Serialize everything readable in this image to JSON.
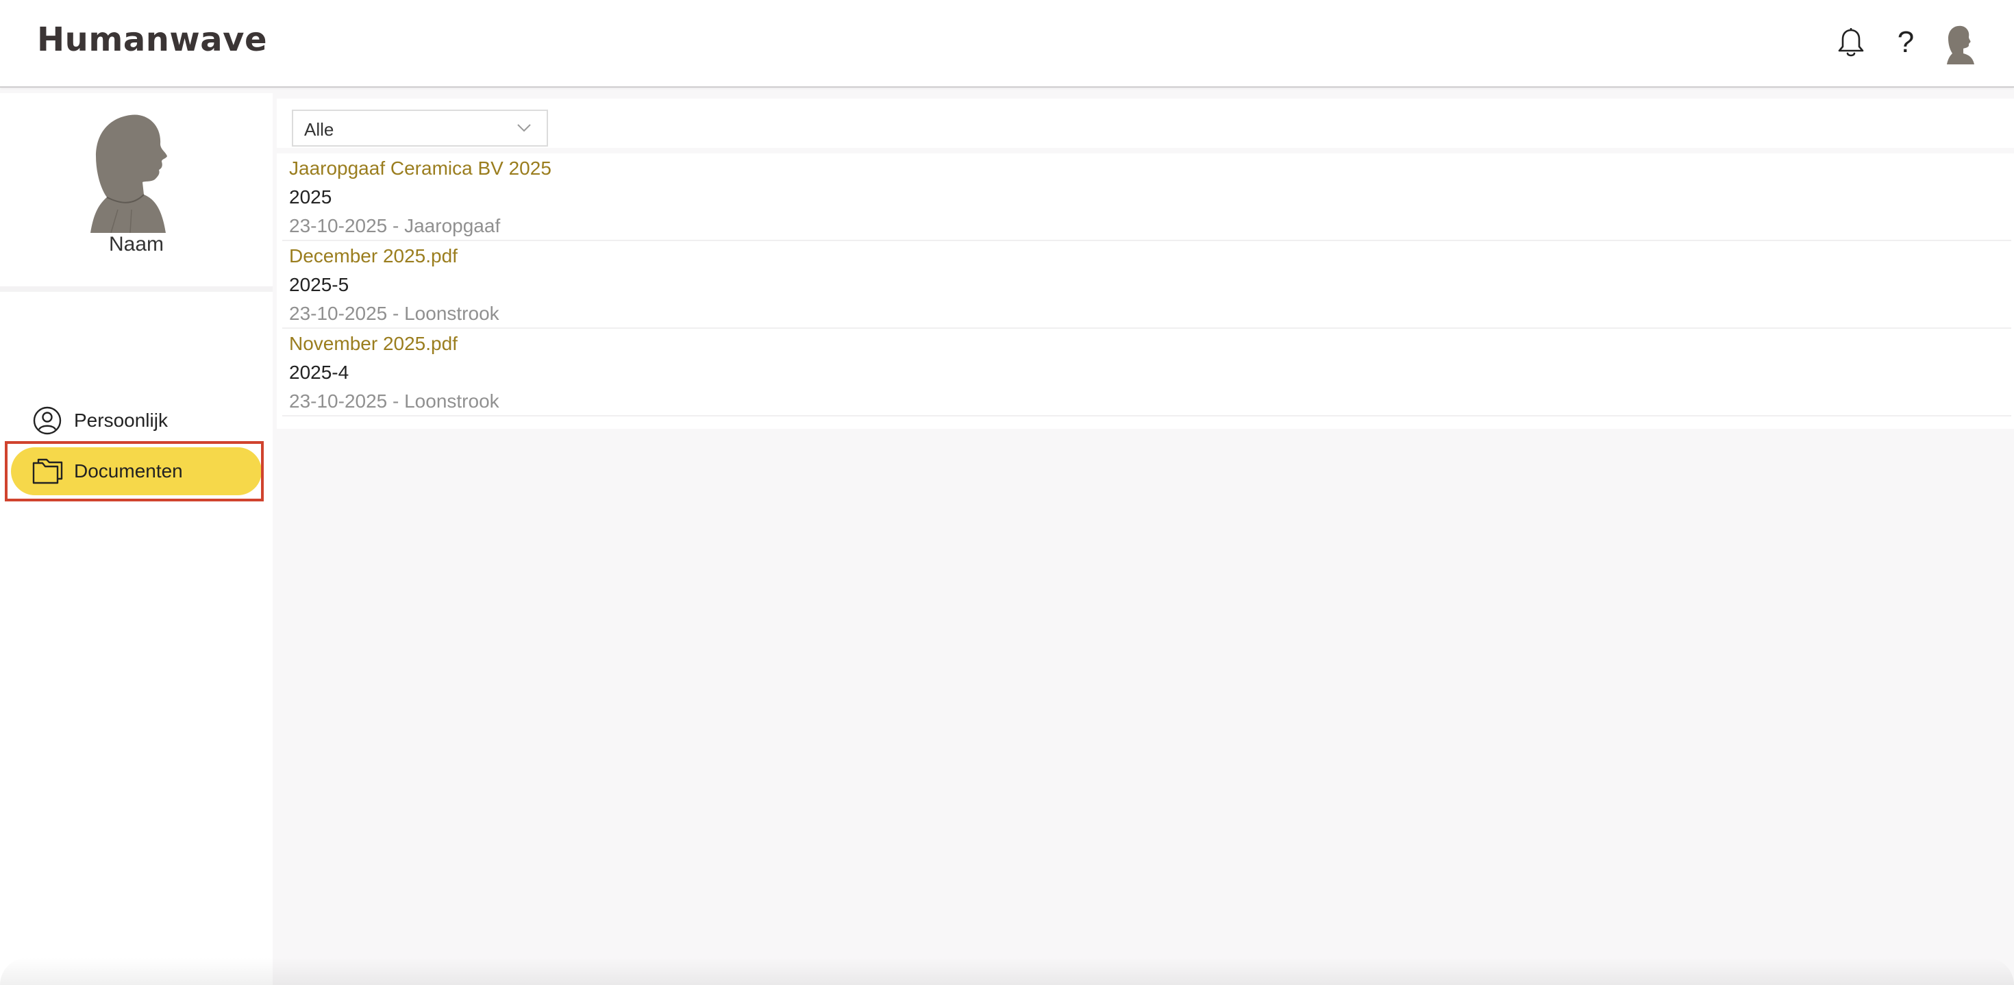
{
  "app": {
    "logo": "Humanwave"
  },
  "header": {
    "icons": [
      "bell-icon",
      "help-icon",
      "user-avatar-icon"
    ],
    "help_glyph": "?"
  },
  "profile": {
    "name": "Naam"
  },
  "sidebar": {
    "items": [
      {
        "label": "Persoonlijk",
        "icon": "user-circle-icon",
        "active": false
      },
      {
        "label": "Documenten",
        "icon": "folder-icon",
        "active": true
      }
    ]
  },
  "filter": {
    "selected": "Alle"
  },
  "documents": [
    {
      "title": "Jaaropgaaf Ceramica BV 2025",
      "subtitle": "2025",
      "meta": "23-10-2025 - Jaaropgaaf"
    },
    {
      "title": "December 2025.pdf",
      "subtitle": "2025-5",
      "meta": "23-10-2025 - Loonstrook"
    },
    {
      "title": "November 2025.pdf",
      "subtitle": "2025-4",
      "meta": "23-10-2025 - Loonstrook"
    }
  ],
  "colors": {
    "accent": "#f6d84a",
    "link": "#9a7d1e",
    "highlight": "#d0432e",
    "background": "#f8f7f8"
  }
}
